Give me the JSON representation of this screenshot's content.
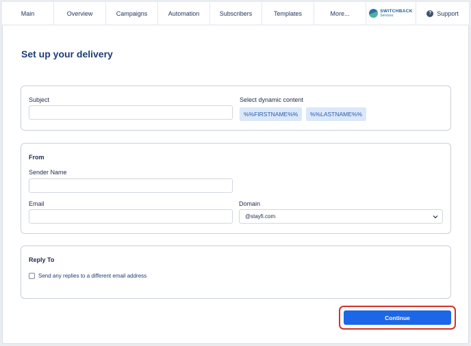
{
  "nav": {
    "items": [
      "Main",
      "Overview",
      "Campaigns",
      "Automation",
      "Subscribers",
      "Templates",
      "More..."
    ],
    "brand": {
      "line1": "SWITCHBACK",
      "line2": "Services",
      "icon": "switchback-logo"
    },
    "support": {
      "label": "Support",
      "icon": "help-circle-icon",
      "glyph": "?"
    }
  },
  "page": {
    "title": "Set up your delivery"
  },
  "subject_section": {
    "subject_label": "Subject",
    "subject_value": "",
    "dynamic_label": "Select dynamic content",
    "chips": [
      "%%FIRSTNAME%%",
      "%%LASTNAME%%"
    ]
  },
  "from_section": {
    "heading": "From",
    "sender_name_label": "Sender Name",
    "sender_name_value": "",
    "email_label": "Email",
    "email_value": "",
    "domain_label": "Domain",
    "domain_value": "@stayfi.com"
  },
  "reply_section": {
    "heading": "Reply To",
    "checkbox_label": "Send any replies to a different email address",
    "checked": false
  },
  "actions": {
    "continue_label": "Continue"
  },
  "colors": {
    "accent": "#1c66e8",
    "highlight": "#d42e25",
    "title": "#1c3c74"
  }
}
